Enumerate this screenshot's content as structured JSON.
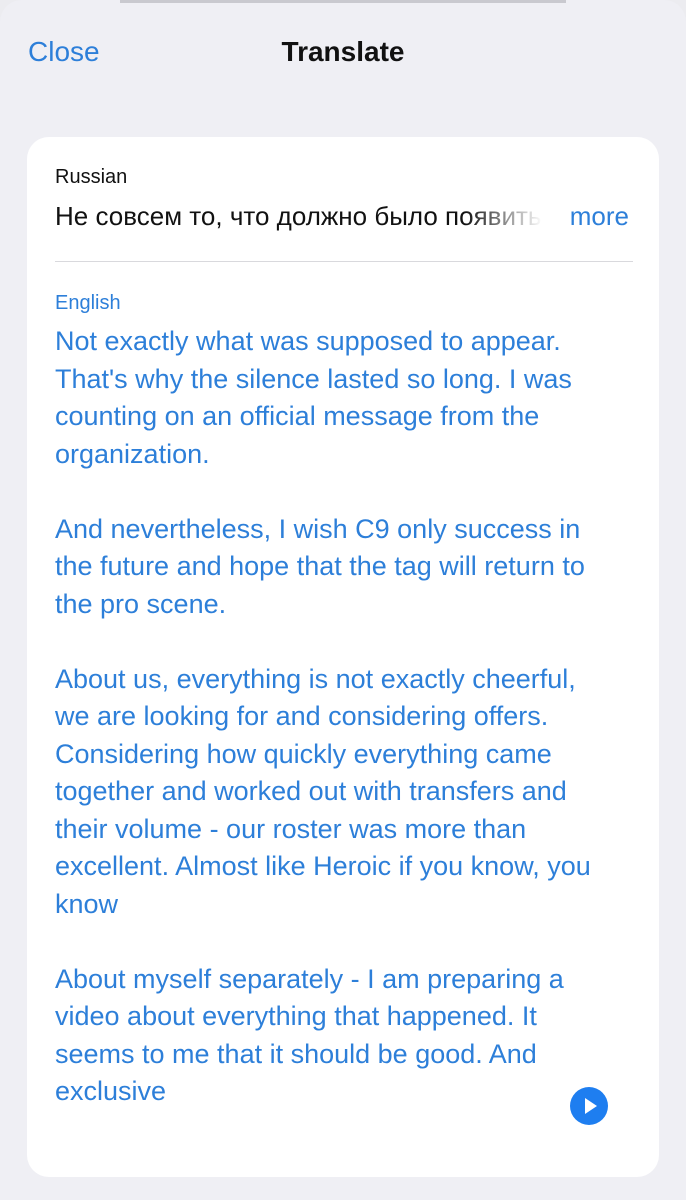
{
  "nav": {
    "close_label": "Close",
    "title": "Translate"
  },
  "source": {
    "language": "Russian",
    "text": "Не совсем то, что должно было появиться",
    "more_label": "more"
  },
  "target": {
    "language": "English",
    "paragraphs": [
      "Not exactly what was supposed to appear. That's why the silence lasted so long. I was counting on an official message from the organization.",
      "And nevertheless, I wish C9 only success in the future and hope that the tag will return to the pro scene.",
      "About us, everything is not exactly cheerful, we are looking for and considering offers. Considering how quickly everything came together and worked out with transfers and their volume - our roster was more than excellent. Almost like Heroic if you know, you know",
      "About myself separately - I am preparing a video about everything that happened. It seems to me that it should be good. And exclusive"
    ]
  },
  "icons": {
    "play": "play-icon"
  },
  "colors": {
    "accent": "#2d7fd9",
    "play_button": "#1e7ef0",
    "background": "#efeff4",
    "card": "#ffffff"
  }
}
